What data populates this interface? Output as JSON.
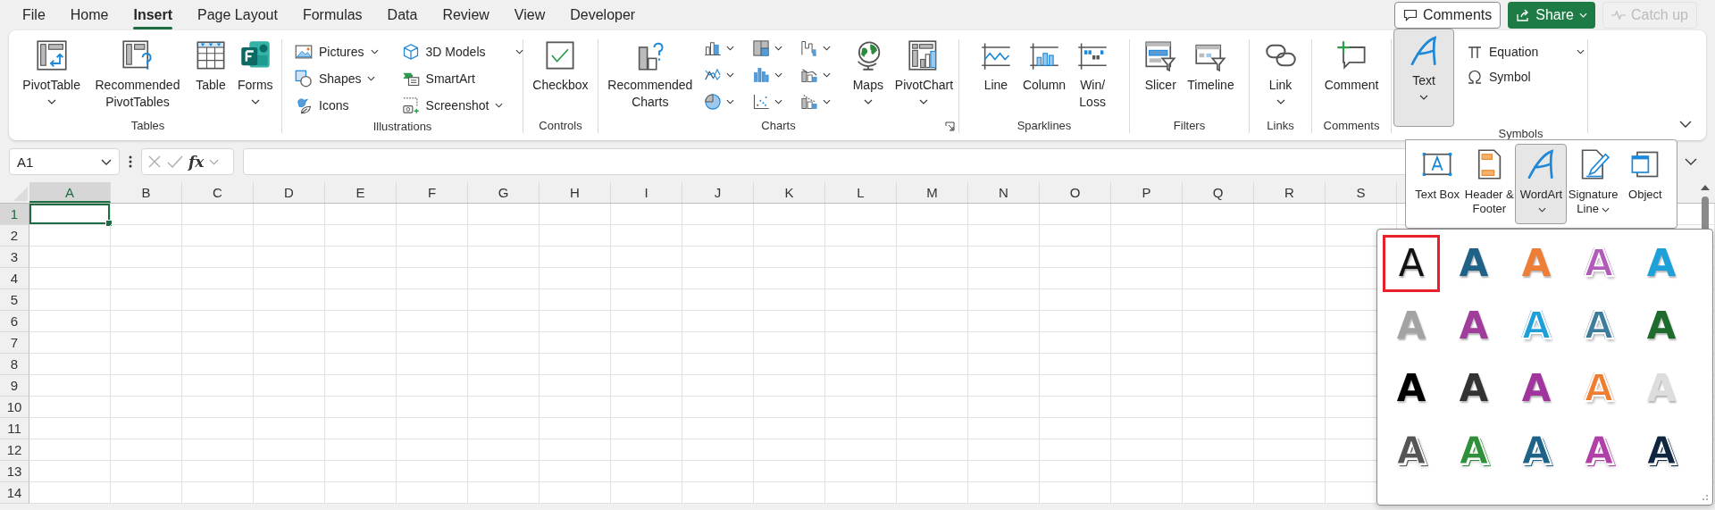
{
  "menu_tabs": [
    {
      "label": "File",
      "selected": false
    },
    {
      "label": "Home",
      "selected": false
    },
    {
      "label": "Insert",
      "selected": true
    },
    {
      "label": "Page Layout",
      "selected": false
    },
    {
      "label": "Formulas",
      "selected": false
    },
    {
      "label": "Data",
      "selected": false
    },
    {
      "label": "Review",
      "selected": false
    },
    {
      "label": "View",
      "selected": false
    },
    {
      "label": "Developer",
      "selected": false
    }
  ],
  "header_buttons": {
    "comments": "Comments",
    "share": "Share",
    "catch_up": {
      "label": "Catch up",
      "disabled": true
    }
  },
  "ribbon": {
    "tables": {
      "label": "Tables",
      "items": [
        {
          "label": "PivotTable",
          "dropdown": true
        },
        {
          "label": "Recommended PivotTables",
          "dropdown": false
        },
        {
          "label": "Table",
          "dropdown": false
        },
        {
          "label": "Forms",
          "dropdown": true
        }
      ]
    },
    "illustrations": {
      "label": "Illustrations",
      "items": [
        {
          "label": "Pictures",
          "dropdown": true
        },
        {
          "label": "Shapes",
          "dropdown": true
        },
        {
          "label": "Icons",
          "dropdown": false
        },
        {
          "label": "3D Models",
          "dropdown": true
        },
        {
          "label": "SmartArt",
          "dropdown": false
        },
        {
          "label": "Screenshot",
          "dropdown": true
        }
      ]
    },
    "controls": {
      "label": "Controls",
      "items": [
        {
          "label": "Checkbox",
          "dropdown": false
        }
      ]
    },
    "charts": {
      "label": "Charts",
      "items": [
        {
          "label": "Recommended Charts",
          "dropdown": false
        },
        {
          "label": "Maps",
          "dropdown": true
        },
        {
          "label": "PivotChart",
          "dropdown": true
        }
      ]
    },
    "sparklines": {
      "label": "Sparklines",
      "items": [
        {
          "label": "Line",
          "dropdown": false
        },
        {
          "label": "Column",
          "dropdown": false
        },
        {
          "label": "Win/Loss",
          "dropdown": false
        }
      ]
    },
    "filters": {
      "label": "Filters",
      "items": [
        {
          "label": "Slicer",
          "dropdown": false
        },
        {
          "label": "Timeline",
          "dropdown": false
        }
      ]
    },
    "links": {
      "label": "Links",
      "items": [
        {
          "label": "Link",
          "dropdown": true
        }
      ]
    },
    "comments": {
      "label": "Comments",
      "items": [
        {
          "label": "Comment",
          "dropdown": false
        }
      ]
    },
    "symbols": {
      "label": "Symbols",
      "text_button": {
        "label": "Text",
        "dropdown": true,
        "expanded": true
      },
      "items": [
        {
          "label": "Equation",
          "dropdown": true
        },
        {
          "label": "Symbol",
          "dropdown": false
        }
      ]
    }
  },
  "formula_bar": {
    "name_box": "A1",
    "function_label": "fx"
  },
  "text_menu": {
    "items": [
      {
        "label": "Text Box",
        "dropdown": false,
        "selected": false
      },
      {
        "label": "Header & Footer",
        "dropdown": false,
        "selected": false
      },
      {
        "label": "WordArt",
        "dropdown": true,
        "selected": true
      },
      {
        "label": "Signature Line",
        "dropdown": true,
        "selected": false
      },
      {
        "label": "Object",
        "dropdown": false,
        "selected": false
      }
    ]
  },
  "wordart_gallery": {
    "styles": [
      {
        "label": "A",
        "kind": "plain",
        "color": "#111111",
        "selected": true
      },
      {
        "label": "A",
        "kind": "fill",
        "color": "#1f6288",
        "selected": false
      },
      {
        "label": "A",
        "kind": "fill",
        "color": "#ee7d36",
        "selected": false
      },
      {
        "label": "A",
        "kind": "outline",
        "color": "#b05cb8",
        "selected": false
      },
      {
        "label": "A",
        "kind": "fill",
        "color": "#1ea0d8",
        "selected": false
      },
      {
        "label": "A",
        "kind": "fill",
        "color": "#a3a3a3",
        "selected": false
      },
      {
        "label": "A",
        "kind": "fill",
        "color": "#a03c9c",
        "selected": false
      },
      {
        "label": "A",
        "kind": "outline",
        "color": "#1e9fd8",
        "selected": false
      },
      {
        "label": "A",
        "kind": "outline",
        "color": "#3e7c9c",
        "selected": false
      },
      {
        "label": "A",
        "kind": "fill",
        "color": "#1e6b2c",
        "selected": false
      },
      {
        "label": "A",
        "kind": "fill",
        "color": "#000000",
        "selected": false
      },
      {
        "label": "A",
        "kind": "fill",
        "color": "#333333",
        "selected": false
      },
      {
        "label": "A",
        "kind": "fill",
        "color": "#a0359e",
        "selected": false
      },
      {
        "label": "A",
        "kind": "outline",
        "color": "#ed7d31",
        "selected": false
      },
      {
        "label": "A",
        "kind": "fill",
        "color": "#dddddd",
        "selected": false
      },
      {
        "label": "A",
        "kind": "striped",
        "color": "#555555",
        "selected": false
      },
      {
        "label": "A",
        "kind": "striped",
        "color": "#2f8f3a",
        "selected": false
      },
      {
        "label": "A",
        "kind": "striped",
        "color": "#1f6288",
        "selected": false
      },
      {
        "label": "A",
        "kind": "striped",
        "color": "#b040a8",
        "selected": false
      },
      {
        "label": "A",
        "kind": "striped",
        "color": "#0f2540",
        "selected": false
      }
    ]
  },
  "sheet": {
    "columns": [
      {
        "label": "A",
        "selected": true
      },
      {
        "label": "B",
        "selected": false
      },
      {
        "label": "C",
        "selected": false
      },
      {
        "label": "D",
        "selected": false
      },
      {
        "label": "E",
        "selected": false
      },
      {
        "label": "F",
        "selected": false
      },
      {
        "label": "G",
        "selected": false
      },
      {
        "label": "H",
        "selected": false
      },
      {
        "label": "I",
        "selected": false
      },
      {
        "label": "J",
        "selected": false
      },
      {
        "label": "K",
        "selected": false
      },
      {
        "label": "L",
        "selected": false
      },
      {
        "label": "M",
        "selected": false
      },
      {
        "label": "N",
        "selected": false
      },
      {
        "label": "O",
        "selected": false
      },
      {
        "label": "P",
        "selected": false
      },
      {
        "label": "Q",
        "selected": false
      },
      {
        "label": "R",
        "selected": false
      },
      {
        "label": "S",
        "selected": false
      }
    ],
    "rows": [
      {
        "label": "1",
        "selected": true
      },
      {
        "label": "2",
        "selected": false
      },
      {
        "label": "3",
        "selected": false
      },
      {
        "label": "4",
        "selected": false
      },
      {
        "label": "5",
        "selected": false
      },
      {
        "label": "6",
        "selected": false
      },
      {
        "label": "7",
        "selected": false
      },
      {
        "label": "8",
        "selected": false
      },
      {
        "label": "9",
        "selected": false
      },
      {
        "label": "10",
        "selected": false
      },
      {
        "label": "11",
        "selected": false
      },
      {
        "label": "12",
        "selected": false
      },
      {
        "label": "13",
        "selected": false
      },
      {
        "label": "14",
        "selected": false
      }
    ]
  }
}
